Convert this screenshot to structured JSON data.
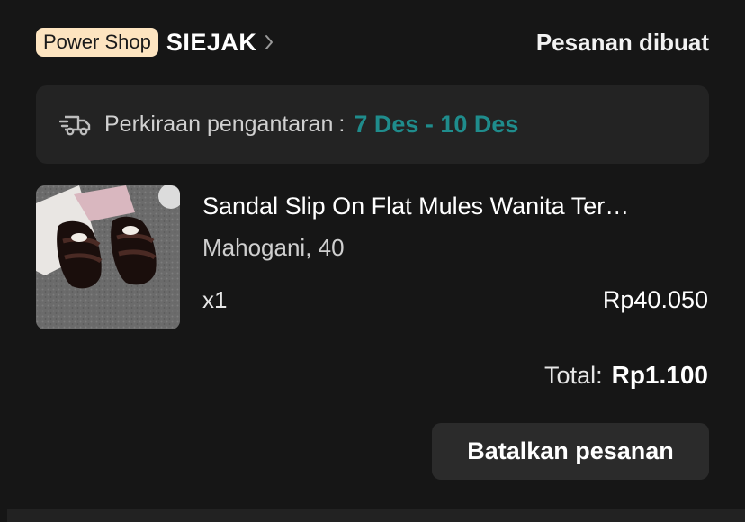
{
  "header": {
    "badge": "Power Shop",
    "shop_name": "SIEJAK",
    "status": "Pesanan dibuat",
    "chevron_icon": "chevron-right-icon"
  },
  "delivery": {
    "icon": "delivery-truck-icon",
    "label": "Perkiraan pengantaran",
    "separator": ":",
    "date_range": "7 Des - 10 Des",
    "accent_color": "#1f8c8c"
  },
  "product": {
    "title": "Sandal Slip On Flat Mules Wanita Ter…",
    "variant": "Mahogani, 40",
    "quantity": "x1",
    "price": "Rp40.050"
  },
  "summary": {
    "total_label": "Total:",
    "total_value": "Rp1.100"
  },
  "actions": {
    "cancel_label": "Batalkan pesanan"
  }
}
